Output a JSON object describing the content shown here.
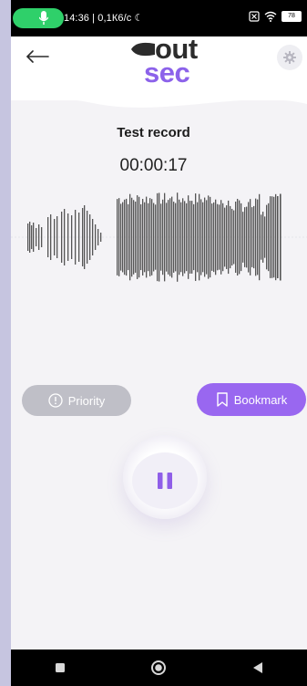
{
  "status": {
    "text": "14:36 | 0,1К6/с ☾",
    "battery": "78"
  },
  "header": {
    "logo_top": "out",
    "logo_bottom": "sec"
  },
  "recording": {
    "title": "Test record",
    "timer": "00:00:17"
  },
  "actions": {
    "priority_label": "Priority",
    "bookmark_label": "Bookmark"
  },
  "colors": {
    "accent": "#9967f0",
    "priority_disabled": "#bfbfc7",
    "status_green": "#2fd06a"
  }
}
